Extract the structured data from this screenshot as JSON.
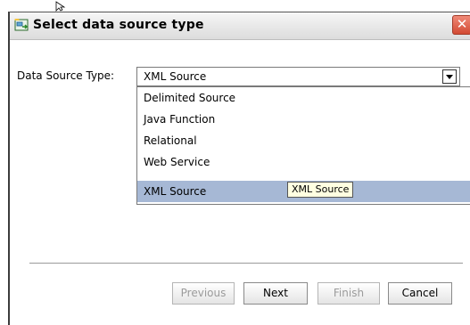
{
  "dialog": {
    "title": "Select data source type",
    "close_label": "✕"
  },
  "form": {
    "field_label": "Data Source Type:",
    "selected_value": "XML Source",
    "options": [
      {
        "label": "Delimited Source"
      },
      {
        "label": "Java Function"
      },
      {
        "label": "Relational"
      },
      {
        "label": "Web Service"
      },
      {
        "label": "XML Source",
        "highlighted": true
      }
    ],
    "tooltip": "XML Source"
  },
  "buttons": {
    "previous": "Previous",
    "next": "Next",
    "finish": "Finish",
    "cancel": "Cancel"
  },
  "colors": {
    "highlight": "#a6b8d5",
    "tooltip_bg": "#ffffe1",
    "close_red": "#d24a33"
  }
}
